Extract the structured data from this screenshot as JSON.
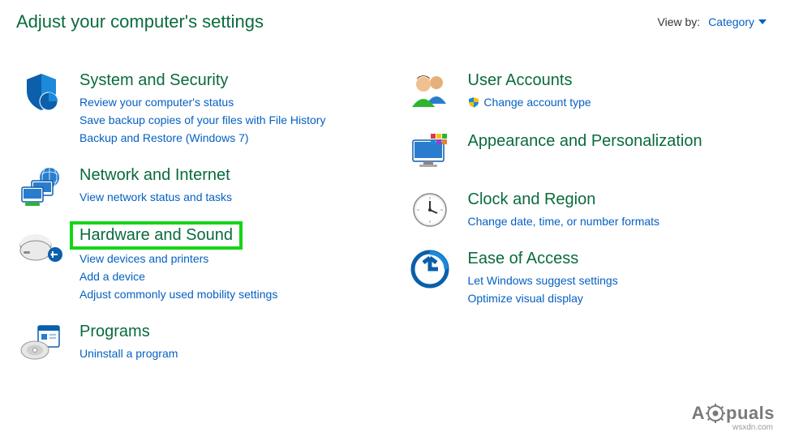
{
  "header": {
    "title": "Adjust your computer's settings",
    "viewby_label": "View by:",
    "viewby_value": "Category"
  },
  "left": {
    "system": {
      "title": "System and Security",
      "links": [
        "Review your computer's status",
        "Save backup copies of your files with File History",
        "Backup and Restore (Windows 7)"
      ]
    },
    "network": {
      "title": "Network and Internet",
      "links": [
        "View network status and tasks"
      ]
    },
    "hardware": {
      "title": "Hardware and Sound",
      "links": [
        "View devices and printers",
        "Add a device",
        "Adjust commonly used mobility settings"
      ]
    },
    "programs": {
      "title": "Programs",
      "links": [
        "Uninstall a program"
      ]
    }
  },
  "right": {
    "users": {
      "title": "User Accounts",
      "links": [
        "Change account type"
      ]
    },
    "appearance": {
      "title": "Appearance and Personalization",
      "links": []
    },
    "clock": {
      "title": "Clock and Region",
      "links": [
        "Change date, time, or number formats"
      ]
    },
    "ease": {
      "title": "Ease of Access",
      "links": [
        "Let Windows suggest settings",
        "Optimize visual display"
      ]
    }
  },
  "watermark": {
    "prefix": "A",
    "suffix": "puals"
  },
  "source": "wsxdn.com"
}
